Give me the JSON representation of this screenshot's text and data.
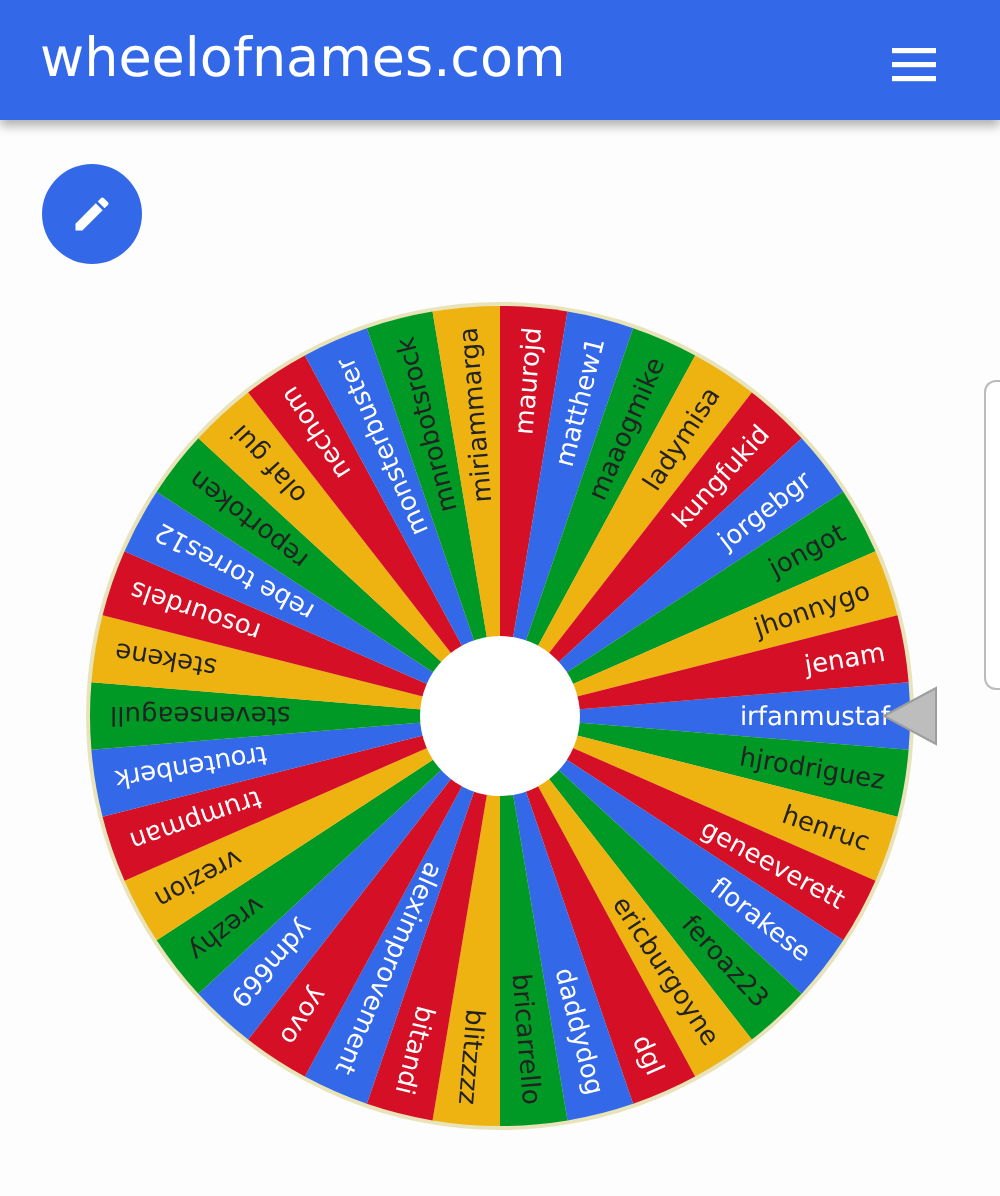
{
  "header": {
    "title": "wheelofnames.com"
  },
  "wheel": {
    "slices": [
      {
        "name": "irfanmustaf"
      },
      {
        "name": "hjrodriguez"
      },
      {
        "name": "henruc"
      },
      {
        "name": "geneeverett"
      },
      {
        "name": "florakese"
      },
      {
        "name": "feroaz23"
      },
      {
        "name": "ericburgoyne"
      },
      {
        "name": "dgl"
      },
      {
        "name": "daddydog"
      },
      {
        "name": "bricarrello"
      },
      {
        "name": "blitzzzz"
      },
      {
        "name": "bitandi"
      },
      {
        "name": "aleximprovement"
      },
      {
        "name": "yovo"
      },
      {
        "name": "ydm669"
      },
      {
        "name": "vrezhy"
      },
      {
        "name": "vrezion"
      },
      {
        "name": "trumpman"
      },
      {
        "name": "troutenberk"
      },
      {
        "name": "stevenseagull"
      },
      {
        "name": "stekene"
      },
      {
        "name": "rosourdels"
      },
      {
        "name": "rebe torres12"
      },
      {
        "name": "reportoken"
      },
      {
        "name": "olaf gui"
      },
      {
        "name": "nechom"
      },
      {
        "name": "monsterbuster"
      },
      {
        "name": "mnrobotsrock"
      },
      {
        "name": "miriammarga"
      },
      {
        "name": "maurojd"
      },
      {
        "name": "matthew1"
      },
      {
        "name": "maaogmike"
      },
      {
        "name": "ladymisa"
      },
      {
        "name": "kungfukid"
      },
      {
        "name": "jorgebgr"
      },
      {
        "name": "jongot"
      },
      {
        "name": "jhonnygo"
      },
      {
        "name": "jenam"
      }
    ]
  }
}
